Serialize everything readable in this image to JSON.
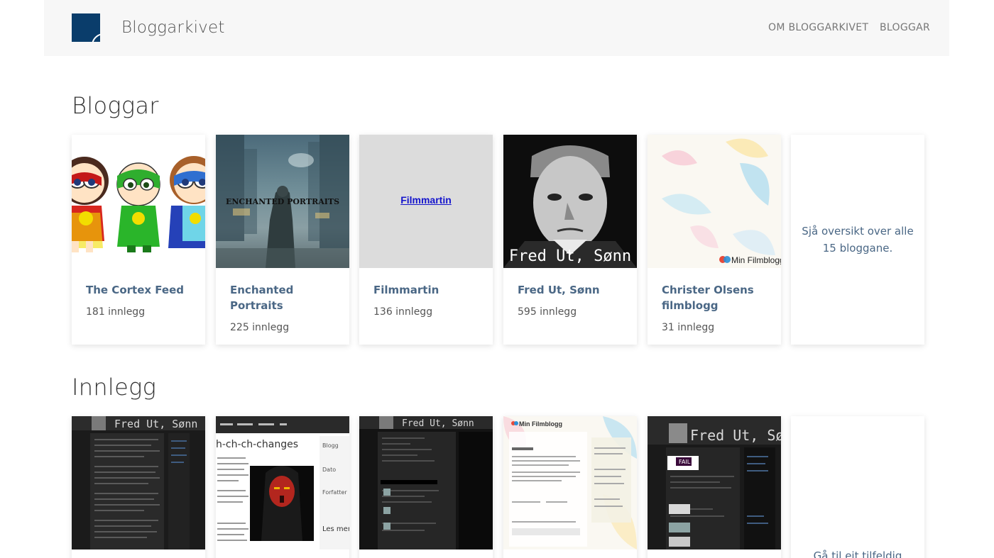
{
  "header": {
    "brand": "Bloggarkivet",
    "nav": [
      "OM BLOGGARKIVET",
      "BLOGGAR"
    ]
  },
  "sections": {
    "blogs_title": "Bloggar",
    "posts_title": "Innlegg"
  },
  "blogs": [
    {
      "title": "The Cortex Feed",
      "count": "181 innlegg"
    },
    {
      "title": "Enchanted Portraits",
      "count": "225 innlegg",
      "thumb_text": "ENCHANTED PORTRAITS"
    },
    {
      "title": "Filmmartin",
      "count": "136 innlegg",
      "thumb_text": "Filmmartin"
    },
    {
      "title": "Fred Ut, Sønn",
      "count": "595 innlegg",
      "thumb_text": "Fred Ut, Sønn"
    },
    {
      "title": "Christer Olsens filmblogg",
      "count": "31 innlegg",
      "thumb_text": "Min Filmblogg"
    }
  ],
  "blogs_more": "Sjå oversikt over alle 15 bloggane.",
  "posts": [
    {
      "kind": "dark",
      "thumb_text": "Fred Ut, Sønn"
    },
    {
      "kind": "light",
      "thumb_text": "h-ch-ch-changes",
      "side": [
        "Blogg",
        "Dato",
        "Forfatter",
        "Les mer"
      ]
    },
    {
      "kind": "dark",
      "thumb_text": "Fred Ut, Sønn"
    },
    {
      "kind": "light",
      "thumb_text": "Min Filmblogg"
    },
    {
      "kind": "dark",
      "thumb_text": "Fred Ut, Sønn",
      "badge": "FAIL"
    }
  ],
  "posts_more": "Gå til eit tilfeldig"
}
